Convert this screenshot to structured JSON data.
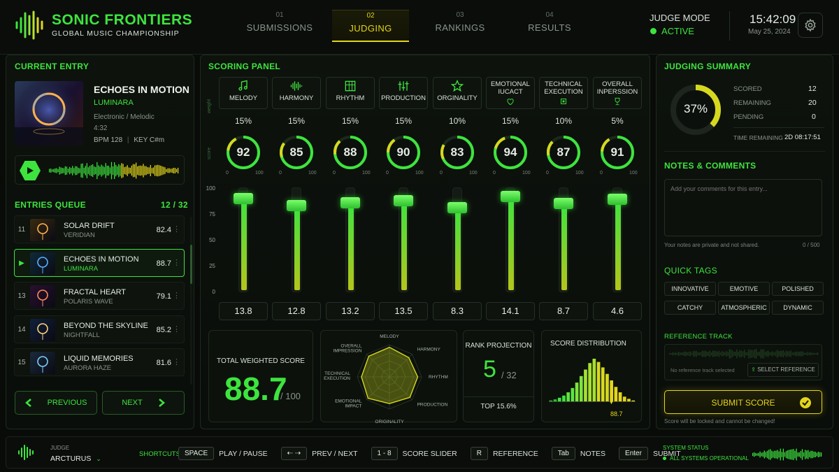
{
  "header": {
    "brand_title": "SONIC FRONTIERS",
    "brand_subtitle": "GLOBAL MUSIC CHAMPIONSHIP",
    "tabs": [
      {
        "num": "01",
        "label": "SUBMISSIONS"
      },
      {
        "num": "02",
        "label": "JUDGING"
      },
      {
        "num": "03",
        "label": "RANKINGS"
      },
      {
        "num": "04",
        "label": "RESULTS"
      }
    ],
    "judge_mode_label": "JUDGE MODE",
    "judge_mode_value": "ACTIVE",
    "time": "15:42:09",
    "date": "May 25, 2024"
  },
  "current_entry": {
    "title": "CURRENT ENTRY",
    "track": "ECHOES IN MOTION",
    "artist": "LUMINARA",
    "genre": "Electronic / Melodic",
    "duration": "4:32",
    "bpm": "BPM 128",
    "key": "KEY C#m"
  },
  "queue": {
    "title": "ENTRIES QUEUE",
    "count": "12 / 32",
    "items": [
      {
        "num": "11",
        "title": "SOLAR DRIFT",
        "artist": "VERIDIAN",
        "score": "82.4"
      },
      {
        "num": "",
        "title": "ECHOES IN MOTION",
        "artist": "LUMINARA",
        "score": "88.7"
      },
      {
        "num": "13",
        "title": "FRACTAL HEART",
        "artist": "POLARIS WAVE",
        "score": "79.1"
      },
      {
        "num": "14",
        "title": "BEYOND THE SKYLINE",
        "artist": "NIGHTFALL",
        "score": "85.2"
      },
      {
        "num": "15",
        "title": "LIQUID MEMORIES",
        "artist": "AURORA HAZE",
        "score": "81.6"
      }
    ],
    "previous_label": "PREVIOUS",
    "next_label": "NEXT"
  },
  "scoring": {
    "title": "SCORING PANEL",
    "side_label_top": "weight",
    "side_label_bottom": "score",
    "categories": [
      {
        "label": "MELODY",
        "icon": "music-note-icon",
        "weight": "15%",
        "score": 92,
        "value": "13.8"
      },
      {
        "label": "HARMONY",
        "icon": "waveform-icon",
        "weight": "15%",
        "score": 85,
        "value": "12.8"
      },
      {
        "label": "RHYTHM",
        "icon": "grid-icon",
        "weight": "15%",
        "score": 88,
        "value": "13.2"
      },
      {
        "label": "PRODUCTION",
        "icon": "mixer-icon",
        "weight": "15%",
        "score": 90,
        "value": "13.5"
      },
      {
        "label": "ORGINALITY",
        "icon": "star-icon",
        "weight": "10%",
        "score": 83,
        "value": "8.3"
      },
      {
        "label": "EMOTIONAL IUCACT",
        "icon": "heart-icon",
        "weight": "15%",
        "score": 94,
        "value": "14.1"
      },
      {
        "label": "TECHNICAL EXECUTION",
        "icon": "chip-icon",
        "weight": "10%",
        "score": 87,
        "value": "8.7"
      },
      {
        "label": "OVERALL INPERSSION",
        "icon": "trophy-icon",
        "weight": "5%",
        "score": 91,
        "value": "4.6"
      }
    ],
    "dial_min": "0",
    "dial_max": "100",
    "scale": [
      "100",
      "75",
      "50",
      "25",
      "0"
    ]
  },
  "total": {
    "label": "TOTAL WEIGHTED SCORE",
    "value": "88.7",
    "max": "/ 100"
  },
  "radar": {
    "labels": [
      "MELODY",
      "HARMONY",
      "RHYTHM",
      "PRODUCTION",
      "ORIGINALITY",
      "EMOTIONAL IMPACT",
      "TECHNICAL EXECUTION",
      "OVERALL IMPRESSION"
    ],
    "values": [
      92,
      85,
      88,
      90,
      83,
      94,
      87,
      91
    ]
  },
  "rank": {
    "label": "RANK PROJECTION",
    "value": "5",
    "total": "/ 32",
    "top": "TOP 15.6%"
  },
  "distribution": {
    "label": "SCORE DISTRIBUTION",
    "marker": "88.7",
    "bars": [
      3,
      5,
      8,
      12,
      18,
      26,
      36,
      48,
      60,
      72,
      80,
      74,
      64,
      52,
      40,
      28,
      18,
      10,
      6,
      3
    ]
  },
  "summary": {
    "title": "JUDGING SUMMARY",
    "progress": 37,
    "progress_label": "37%",
    "scored_label": "SCORED",
    "scored": "12",
    "remaining_label": "REMAINING",
    "remaining": "20",
    "pending_label": "PENDING",
    "pending": "0",
    "time_label": "TIME REMAINING",
    "time": "2D 08:17:51"
  },
  "notes": {
    "title": "NOTES & COMMENTS",
    "placeholder": "Add your comments for this entry...",
    "privacy": "Your notes are private and not shared.",
    "counter": "0 / 500"
  },
  "tags": {
    "title": "QUICK TAGS",
    "items": [
      "INNOVATIVE",
      "EMOTIVE",
      "POLISHED",
      "CATCHY",
      "ATMOSPHERIC",
      "DYNAMIC"
    ]
  },
  "reference": {
    "title": "REFERENCE TRACK",
    "empty": "No reference track selected",
    "select": "SELECT REFERENCE"
  },
  "submit": {
    "label": "SUBMIT SCORE",
    "warning": "Score will be locked and cannot be changed!"
  },
  "footer": {
    "judge_label": "JUDGE",
    "judge_name": "ARCTURUS",
    "shortcuts_label": "SHORTCUTS",
    "shortcuts": [
      {
        "key": "SPACE",
        "action": "PLAY / PAUSE"
      },
      {
        "key": "⇠ ⇢",
        "action": "PREV / NEXT"
      },
      {
        "key": "1 - 8",
        "action": "SCORE SLIDER"
      },
      {
        "key": "R",
        "action": "REFERENCE"
      },
      {
        "key": "Tab",
        "action": "NOTES"
      },
      {
        "key": "Enter",
        "action": "SUBMIT"
      }
    ],
    "status_label": "SYSTEM STATUS",
    "status_value": "ALL SYSTEMS OPERATIONAL"
  },
  "colors": {
    "accent": "#3ee43e",
    "highlight": "#e3d51c",
    "bg": "#080b08"
  }
}
